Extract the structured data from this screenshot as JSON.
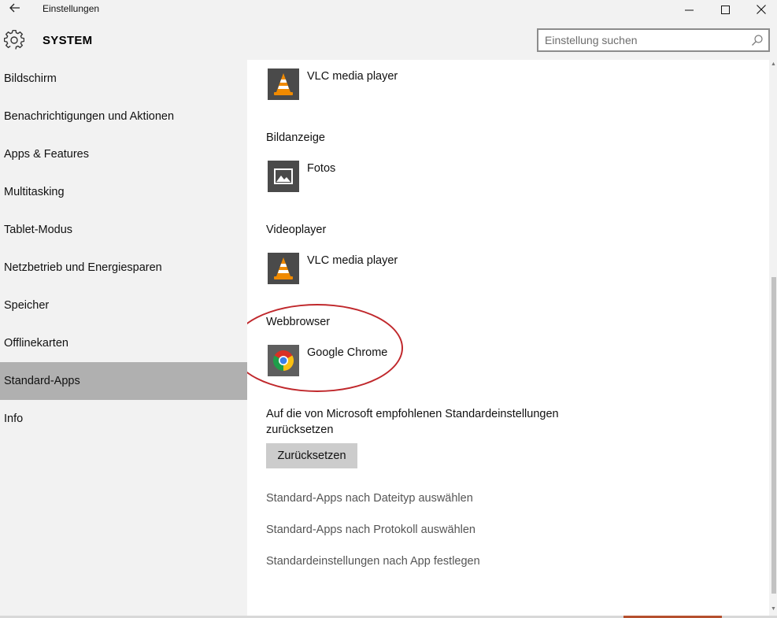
{
  "window": {
    "title": "Einstellungen",
    "back_icon": "arrow-left-icon",
    "controls": [
      "minimize-icon",
      "maximize-icon",
      "close-icon"
    ]
  },
  "header": {
    "icon": "gear-icon",
    "title": "SYSTEM",
    "search": {
      "placeholder": "Einstellung suchen",
      "value": "",
      "icon": "search-icon"
    }
  },
  "sidebar": {
    "items": [
      {
        "label": "Bildschirm",
        "active": false
      },
      {
        "label": "Benachrichtigungen und Aktionen",
        "active": false
      },
      {
        "label": "Apps & Features",
        "active": false
      },
      {
        "label": "Multitasking",
        "active": false
      },
      {
        "label": "Tablet-Modus",
        "active": false
      },
      {
        "label": "Netzbetrieb und Energiesparen",
        "active": false
      },
      {
        "label": "Speicher",
        "active": false
      },
      {
        "label": "Offlinekarten",
        "active": false
      },
      {
        "label": "Standard-Apps",
        "active": true
      },
      {
        "label": "Info",
        "active": false
      }
    ]
  },
  "main": {
    "sections": [
      {
        "heading": "",
        "app": {
          "name": "VLC media player",
          "icon": "vlc-icon"
        }
      },
      {
        "heading": "Bildanzeige",
        "app": {
          "name": "Fotos",
          "icon": "photos-icon"
        }
      },
      {
        "heading": "Videoplayer",
        "app": {
          "name": "VLC media player",
          "icon": "vlc-icon"
        }
      },
      {
        "heading": "Webbrowser",
        "app": {
          "name": "Google Chrome",
          "icon": "chrome-icon"
        },
        "highlighted": true
      }
    ],
    "reset": {
      "description": "Auf die von Microsoft empfohlenen Standardeinstellungen zurücksetzen",
      "button_label": "Zurücksetzen"
    },
    "links": [
      "Standard-Apps nach Dateityp auswählen",
      "Standard-Apps nach Protokoll auswählen",
      "Standardeinstellungen nach App festlegen"
    ]
  },
  "colors": {
    "active_nav": "#b0b0b0",
    "highlight_ellipse": "#c0282c",
    "button_bg": "#cccccc"
  }
}
